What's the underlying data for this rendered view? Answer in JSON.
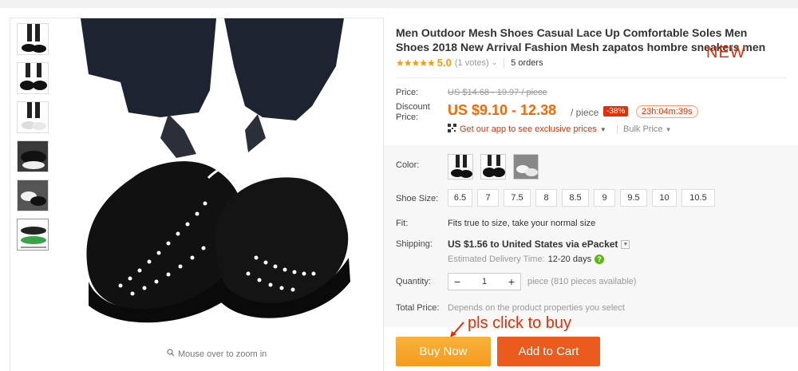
{
  "product": {
    "title": "Men Outdoor Mesh Shoes Casual Lace Up Comfortable Soles Men Shoes 2018 New Arrival Fashion Mesh zapatos hombre sneakers men",
    "new_tag": "NEW",
    "rating": {
      "stars": "★★★★★",
      "score": "5.0",
      "votes": "(1 votes)",
      "orders": "5 orders",
      "value": 5.0
    }
  },
  "price": {
    "label": "Price:",
    "original": "US $14.68 - 19.97 / piece",
    "discount_label": "Discount Price:",
    "current": "US $9.10 - 12.38",
    "per": "/ piece",
    "discount_pct": "-38%",
    "timer": "23h:04m:39s",
    "app_promo": "Get our app to see exclusive prices",
    "bulk": "Bulk Price"
  },
  "options": {
    "color_label": "Color:",
    "size_label": "Shoe Size:",
    "sizes": [
      "6.5",
      "7",
      "7.5",
      "8",
      "8.5",
      "9",
      "9.5",
      "10",
      "10.5"
    ],
    "fit_label": "Fit:",
    "fit_text": "Fits true to size, take your normal size",
    "shipping_label": "Shipping:",
    "shipping_text": "US $1.56 to United States via ePacket",
    "eta_label": "Estimated Delivery Time:",
    "eta_days": "12-20 days",
    "quantity_label": "Quantity:",
    "quantity_value": "1",
    "quantity_avail": "piece (810 pieces available)",
    "total_label": "Total Price:",
    "total_hint": "Depends on the product properties you select"
  },
  "cta": {
    "note": "pls click to buy",
    "buy": "Buy Now",
    "cart": "Add to Cart"
  },
  "gallery": {
    "zoom_hint": "Mouse over to zoom in"
  },
  "colors": {
    "accent": "#e62e04",
    "price": "#ff6600",
    "buy": "#f5a623",
    "cart": "#ec5b1e"
  }
}
